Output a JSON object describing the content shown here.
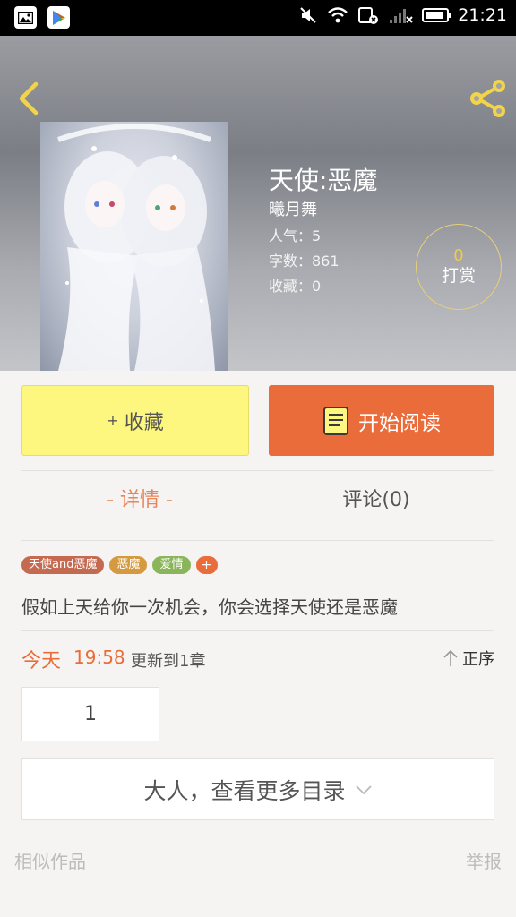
{
  "status_bar": {
    "time": "21:21"
  },
  "book": {
    "title": "天使:恶魔",
    "author": "曦月舞",
    "popularity": "人气：5",
    "word_count": "字数：861",
    "favorites": "收藏：0"
  },
  "tip": {
    "count": "0",
    "label": "打赏"
  },
  "actions": {
    "favorite_plus": "+",
    "favorite_label": "收藏",
    "read_label": "开始阅读"
  },
  "tabs": {
    "detail": "- 详情 -",
    "comment": "评论(0)"
  },
  "tags": [
    {
      "label": "天使and恶魔",
      "color": "#c46a50"
    },
    {
      "label": "恶魔",
      "color": "#d59a3f"
    },
    {
      "label": "爱情",
      "color": "#8ab55a"
    }
  ],
  "tag_add": "+",
  "description": "假如上天给你一次机会，你会选择天使还是恶魔",
  "update": {
    "day": "今天",
    "time": "19:58",
    "text": "更新到1章",
    "sort_label": "正序"
  },
  "chapter": {
    "number": "1"
  },
  "more_catalog": "大人，查看更多目录",
  "footer": {
    "similar": "相似作品",
    "report": "举报"
  },
  "colors": {
    "accent": "#e96c3a",
    "favorite_bg": "#fdf67f",
    "tip_ring": "#e7cf7a"
  }
}
